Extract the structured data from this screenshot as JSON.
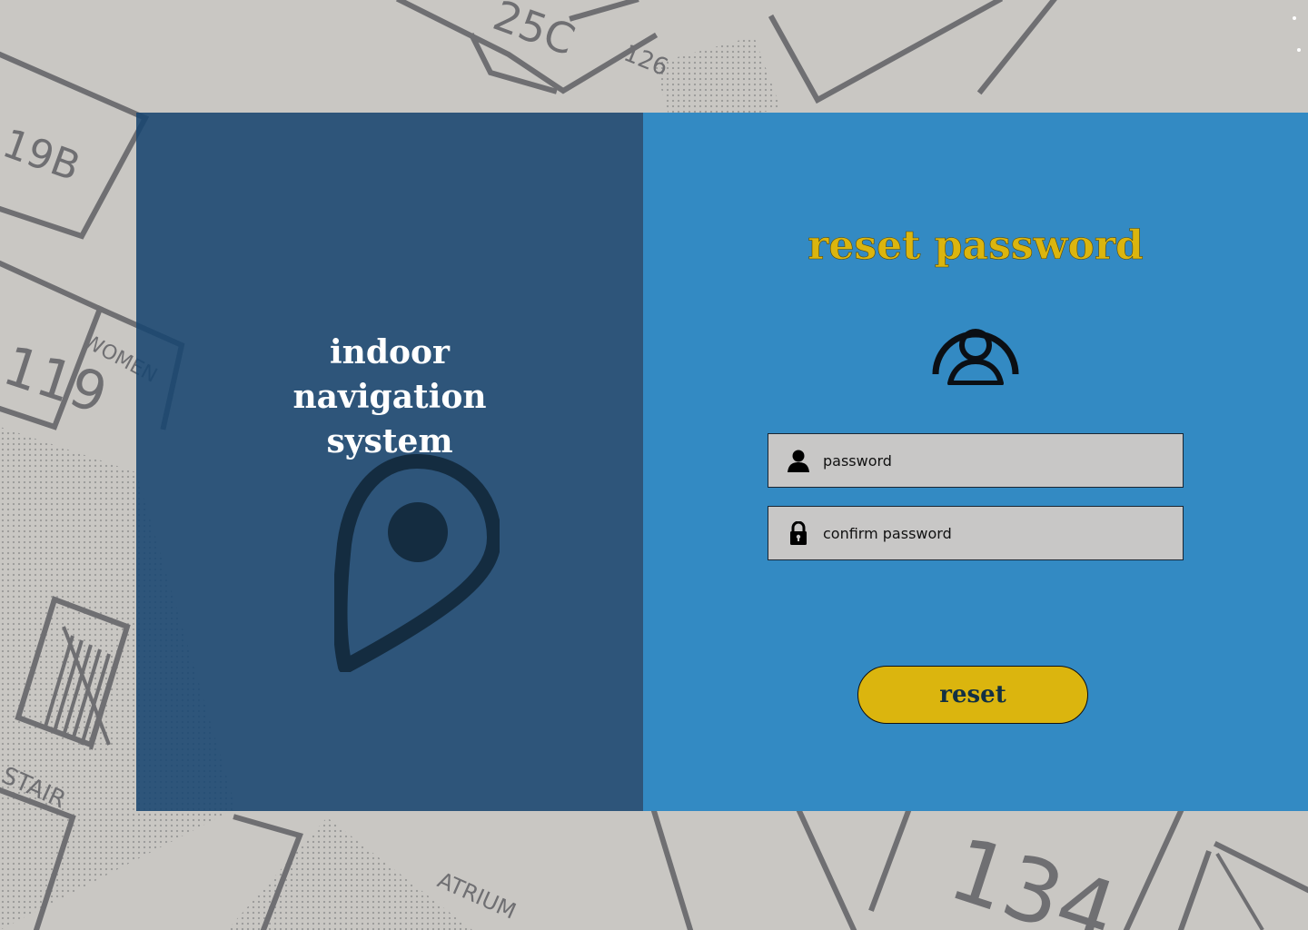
{
  "branding": {
    "title_lines": [
      "indoor",
      "navigation",
      "system"
    ]
  },
  "form": {
    "title": "reset password",
    "password_placeholder": "password",
    "confirm_placeholder": "confirm password",
    "reset_label": "reset"
  },
  "icons": {
    "brand": "map-pin-icon",
    "avatar": "user-circle-icon",
    "password_field": "user-icon",
    "confirm_field": "lock-icon"
  },
  "colors": {
    "left_panel": "#184670",
    "right_panel": "#338ac3",
    "accent": "#dbb50e",
    "field_bg": "#c8c7c6"
  }
}
